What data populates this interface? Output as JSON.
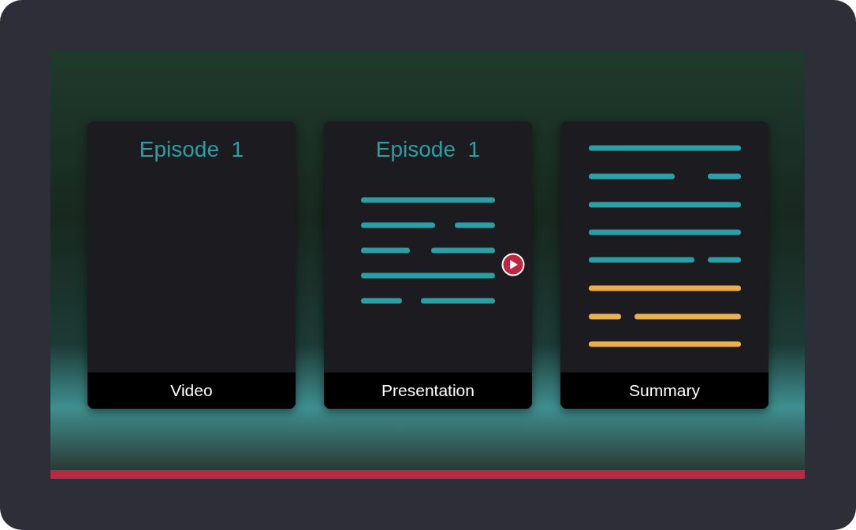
{
  "cards": [
    {
      "kind": "video",
      "title": "Episode  1",
      "label": "Video"
    },
    {
      "kind": "presentation",
      "title": "Episode  1",
      "label": "Presentation"
    },
    {
      "kind": "summary",
      "label": "Summary"
    }
  ],
  "progress": {
    "level": 1
  }
}
